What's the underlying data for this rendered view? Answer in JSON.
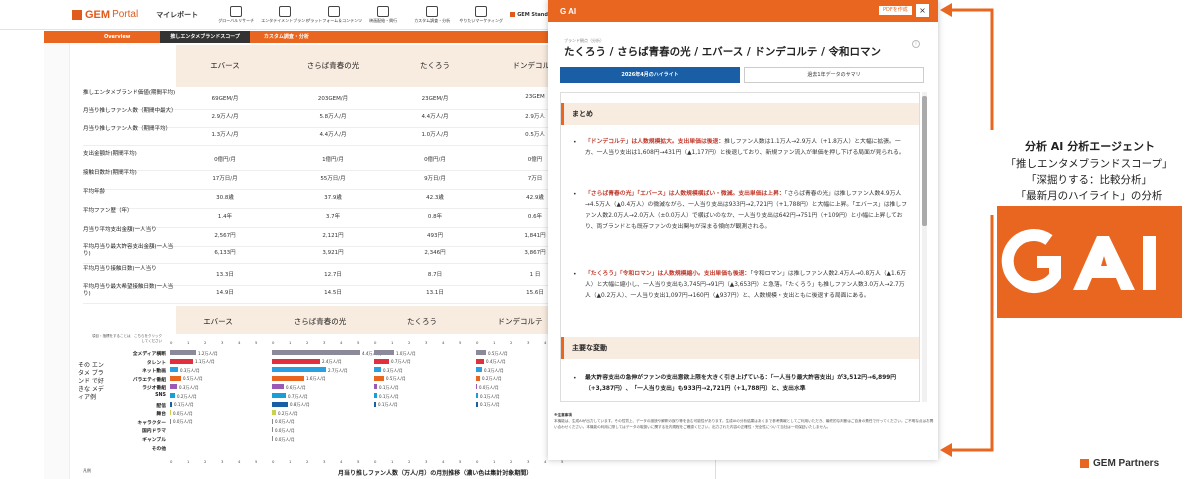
{
  "app": {
    "logo": "GEM",
    "logo_portal": "Portal",
    "mypage": "マイレポート",
    "nav": [
      "グローバルリサーチ",
      "エンタテイメントブランド",
      "プラットフォーム＆コンテンツ",
      "映画配給・興行",
      "カスタム調査・分析",
      "やりたいマーケティング"
    ],
    "gem_standard": "GEM Standard",
    "tabs": [
      "Overview",
      "推しエンタメブランドスコープ",
      "カスタム調査・分析"
    ],
    "columns": [
      "エバース",
      "さらば青春の光",
      "たくろう",
      "ドンデコルテ"
    ],
    "rows": [
      {
        "label": "推しエンタメブランド価値(期間平均)",
        "values": [
          "69GEM/月",
          "203GEM/月",
          "23GEM/月",
          "23GEM"
        ]
      },
      {
        "label": "月当り推しファン人数（期間中最大）",
        "values": [
          "2.9万人/月",
          "5.8万人/月",
          "4.4万人/月",
          "2.9万人"
        ]
      },
      {
        "label": "月当り推しファン人数（期間平均）",
        "values": [
          "1.3万人/月",
          "4.4万人/月",
          "1.0万人/月",
          "0.5万人"
        ]
      },
      {
        "label": "支出金額計(期間平均)",
        "values": [
          "0億円/月",
          "1億円/月",
          "0億円/月",
          "0億円"
        ]
      },
      {
        "label": "接触日数計(期間平均)",
        "values": [
          "17万日/月",
          "55万日/月",
          "9万日/月",
          "7万日"
        ]
      },
      {
        "label": "平均年齢",
        "values": [
          "30.8歳",
          "37.9歳",
          "42.3歳",
          "42.9歳"
        ]
      },
      {
        "label": "平均ファン歴（年）",
        "values": [
          "1.4年",
          "3.7年",
          "0.8年",
          "0.6年"
        ]
      },
      {
        "label": "月当り平均支出金額(一人当り",
        "values": [
          "2,567円",
          "2,121円",
          "493円",
          "1,841円"
        ]
      },
      {
        "label": "平均月当り最大許容支出金額(一人当り)",
        "values": [
          "6,133円",
          "3,921円",
          "2,346円",
          "3,867円"
        ]
      },
      {
        "label": "平均月当り接触日数(一人当り",
        "values": [
          "13.3日",
          "12.7日",
          "8.7日",
          "1 日"
        ]
      },
      {
        "label": "平均月当り最大希望接触日数(一人当り)",
        "values": [
          "14.9日",
          "14.5日",
          "13.1日",
          "15.6日"
        ]
      }
    ],
    "media_hint": "項目・指標をすることは　こちらをクリックしてください",
    "media_side_label": "その エンタメ ブランド で好きな メディア例",
    "media_labels": [
      "全メディア横断",
      "タレント",
      "ネット動画",
      "バラエティ番組",
      "ラジオ番組",
      "SNS",
      "配信",
      "舞台",
      "キャラクター",
      "国内ドラマ",
      "ギャンブル",
      "その他"
    ],
    "media_values": [
      {
        "vals": [
          "1.2万人/月",
          "1.1万人/月",
          "0.3万人/月",
          "0.5万人/月",
          "0.3万人/月",
          "0.2万人/月",
          "0.1万人/月",
          "0.0万人/月",
          "0.0万人/月"
        ],
        "widths": [
          0.26,
          0.23,
          0.08,
          0.11,
          0.07,
          0.05,
          0.02,
          0.01,
          0.005
        ]
      },
      {
        "vals": [
          "4.4万人/月",
          "2.4万人/月",
          "2.7万人/月",
          "1.6万人/月",
          "0.6万人/月",
          "0.7万人/月",
          "0.8万人/月",
          "0.2万人/月",
          "0.0万人/月",
          "0.0万人/月",
          "0.0万人/月"
        ],
        "widths": [
          0.88,
          0.48,
          0.54,
          0.32,
          0.12,
          0.14,
          0.16,
          0.04,
          0.005,
          0.005,
          0.005
        ]
      },
      {
        "vals": [
          "1.0万人/月",
          "0.7万人/月",
          "0.3万人/月",
          "0.5万人/月",
          "0.1万人/月",
          "0.1万人/月",
          "0.1万人/月"
        ],
        "widths": [
          0.2,
          0.15,
          0.07,
          0.1,
          0.03,
          0.03,
          0.02
        ]
      },
      {
        "vals": [
          "0.5万人/月",
          "0.4万人/月",
          "0.3万人/月",
          "0.2万人/月",
          "0.0万人/月",
          "0.1万人/月",
          "0.1万人/月"
        ],
        "widths": [
          0.1,
          0.08,
          0.06,
          0.04,
          0.01,
          0.02,
          0.02
        ]
      }
    ],
    "media_axis": [
      "0",
      "1",
      "2",
      "3",
      "4",
      "5"
    ],
    "bottom_left": "凡例",
    "bottom_title": "月当り推しファン人数（万人/月）の月別推移（濃い色は集計対象期間）"
  },
  "panel": {
    "title": "G AI",
    "pdf": "PDFを作成",
    "close": "×",
    "subhint": "ブランド観点（分析）",
    "subject": "たくろう / さらば青春の光 / エバース / ドンデコルテ / 令和ロマン",
    "tab_active": "2026年4月のハイライト",
    "tab_other": "過去1年データのサマリ",
    "sections": [
      {
        "title": "まとめ",
        "bullets": [
          {
            "hl": "「ドンデコルテ」は人数規模拡大。支出単価は後退：",
            "text": "推しファン人数は1.1万人→2.9万人（+1.8万人）と大幅に拡張。一方、一人当り支出は1,608円→431円（▲1,177円）と後退しており、新規ファン流入が単価を押し下げる局面が見られる。"
          },
          {
            "hl": "「さらば青春の光」「エバース」は人数規模横ばい・微減。支出単価は上昇：",
            "text": "「さらば青春の光」は推しファン人数4.9万人→4.5万人（▲0.4万人）の微減ながら、一人当り支出は933円→2,721円（+1,788円）と大幅に上昇。「エバース」は推しファン人数2.0万人→2.0万人（±0.0万人）で横ばいのなか、一人当り支出は642円→751円（+109円）と小幅に上昇しており、両ブランドとも既存ファンの支出関与が深まる傾向が観測される。"
          },
          {
            "hl": "「たくろう」「令和ロマン」は人数規模縮小。支出単価も後退：",
            "text": "「令和ロマン」は推しファン人数2.4万人→0.8万人（▲1.6万人）と大幅に縮小し、一人当り支出も3,745円→91円（▲3,653円）と急落。「たくろう」も推しファン人数3.0万人→2.7万人（▲0.2万人）、一人当り支出1,097円→160円（▲937円）と、人数規模・支出ともに後退する局面にある。"
          }
        ]
      },
      {
        "title": "主要な変動",
        "bullets": [
          {
            "hl": "",
            "text": "最大許容支出の急伸がファンの支出意欲上限を大きく引き上げている：「一人当り最大許容支出」が3,512円→6,899円（+3,387円）、「一人当り支出」も933円→2,721円（+1,788円）と、支出水準"
          }
        ]
      }
    ],
    "note_title": "※注意事項",
    "note_text": "本機能は、生成AIが出力しています。その性質上、データの誤読や解釈の誤り等を含む可能性があります。生成AIの分析結果はあくまで参考情報としてご利用いただき、最終的な判断はご自身の責任で行ってください。ご不明な点はお問い合わせください。本機能の利用に際してはデータの取扱いに関する社内規程をご確認ください。出力された内容の正確性・完全性について当社は一切保証いたしません。"
  },
  "right": {
    "title": "分析 AI 分析エージェント",
    "line1": "「推しエンタメブランドスコープ」",
    "line2": "「深掘りする：比較分析」",
    "line3": "「最新月のハイライト」の分析",
    "gai_text": "G AI",
    "brand": "GEM Partners"
  },
  "colors": {
    "accent": "#e8661f",
    "panel_tab": "#1a5ea6",
    "highlight": "#c0392b",
    "band": "#f8ebdf"
  },
  "icons": [
    "close-icon",
    "info-icon",
    "arrow-icon",
    "gai-logo-icon"
  ]
}
